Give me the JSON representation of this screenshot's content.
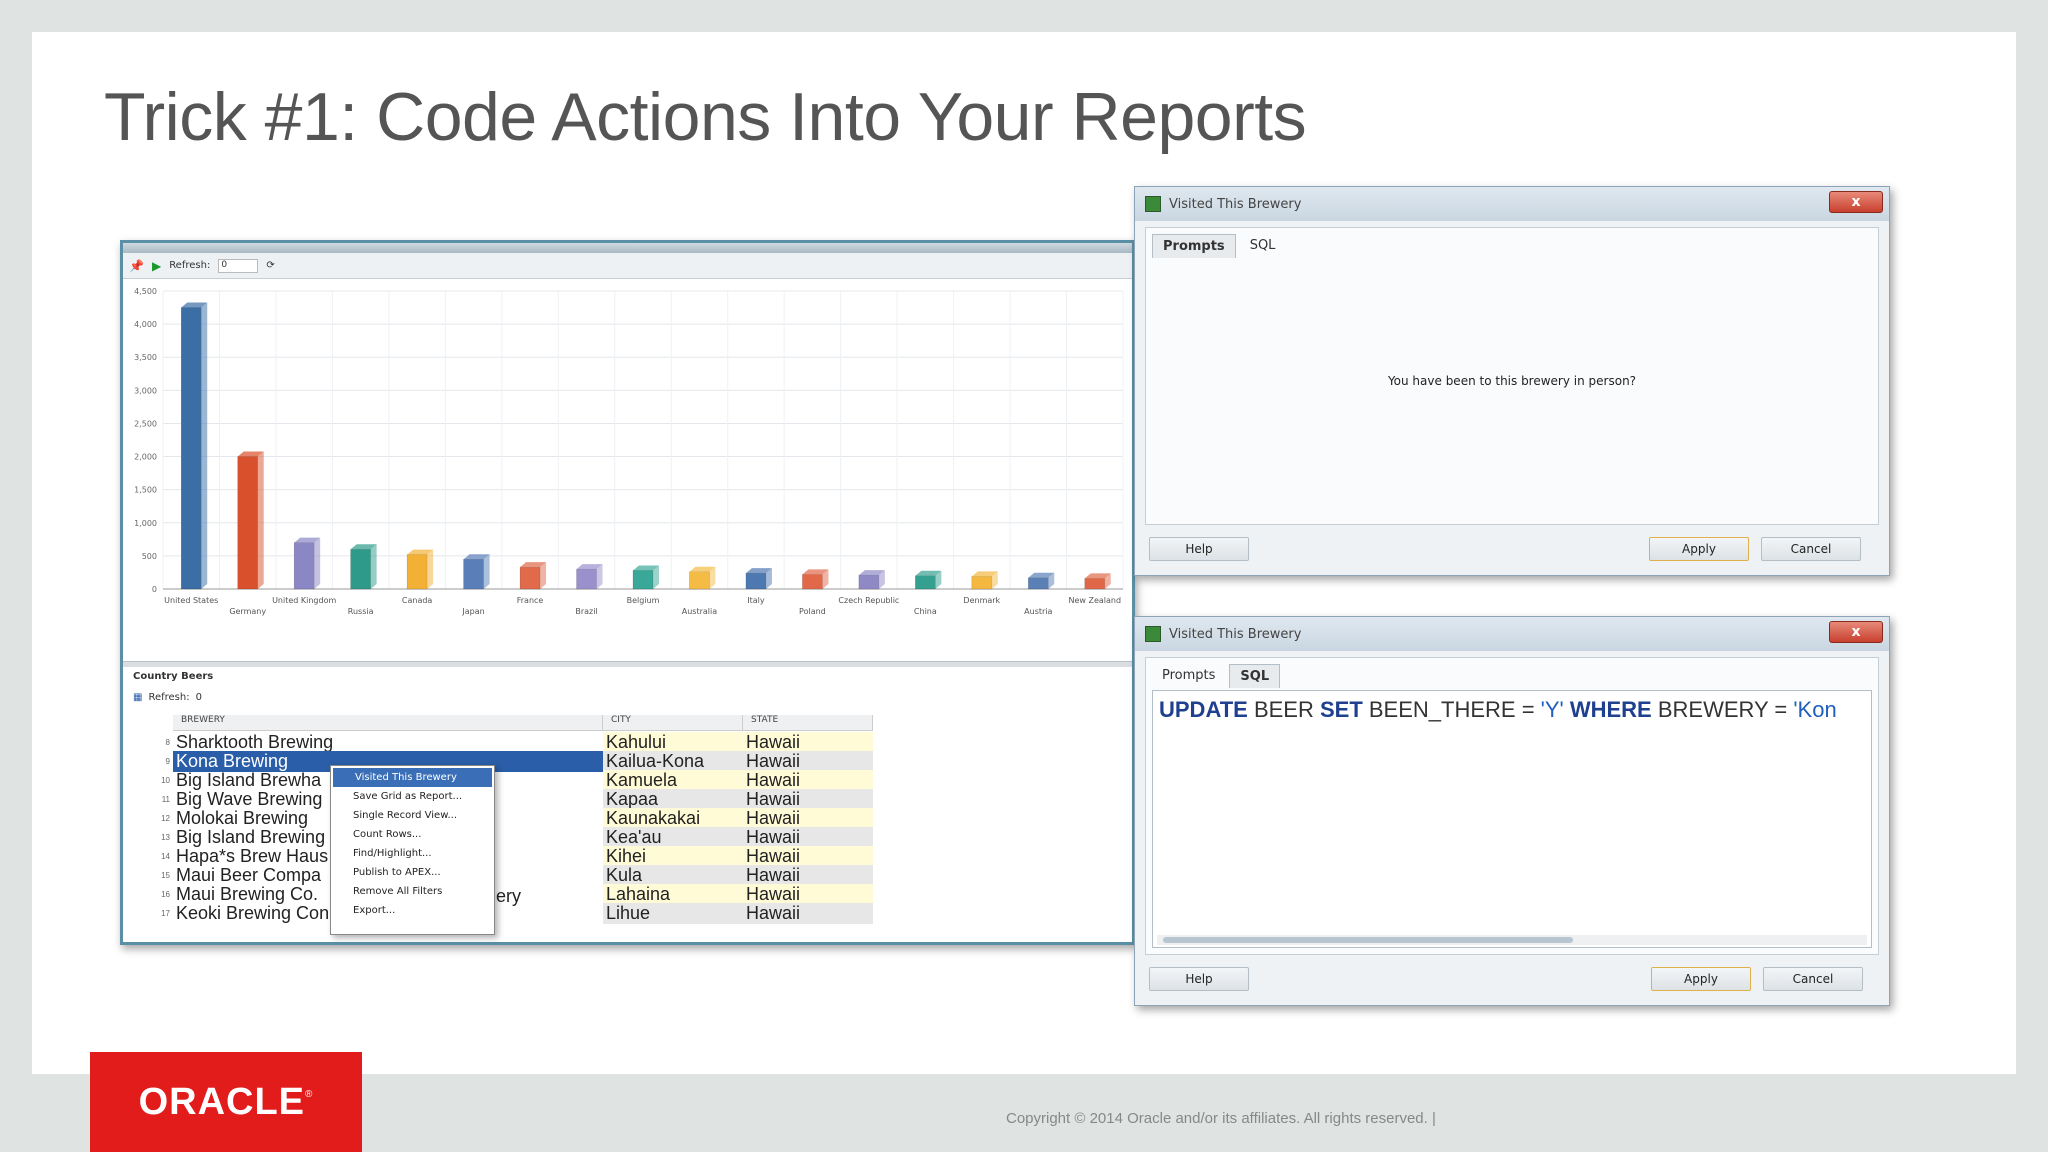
{
  "slide": {
    "title": "Trick #1: Code Actions Into Your Reports",
    "copyright": "Copyright © 2014 Oracle and/or its affiliates. All rights reserved.  |",
    "logo_text": "ORACLE"
  },
  "report": {
    "toolbar_refresh_label": "Refresh:",
    "toolbar_refresh_value": "0",
    "grid_title": "Country Beers",
    "grid_refresh_label": "Refresh:",
    "grid_refresh_value": "0",
    "columns": [
      "BREWERY",
      "CITY",
      "STATE"
    ],
    "rows": [
      {
        "n": "8",
        "brewery": "Sharktooth Brewing",
        "city": "Kahului",
        "state": "Hawaii"
      },
      {
        "n": "9",
        "brewery": "Kona Brewing",
        "city": "Kailua-Kona",
        "state": "Hawaii"
      },
      {
        "n": "10",
        "brewery": "Big Island Brewha",
        "city": "Kamuela",
        "state": "Hawaii"
      },
      {
        "n": "11",
        "brewery": "Big Wave Brewing",
        "city": "Kapaa",
        "state": "Hawaii"
      },
      {
        "n": "12",
        "brewery": "Molokai Brewing",
        "city": "Kaunakakai",
        "state": "Hawaii"
      },
      {
        "n": "13",
        "brewery": "Big Island Brewing",
        "city": "Kea'au",
        "state": "Hawaii"
      },
      {
        "n": "14",
        "brewery": "Hapa*s Brew Haus",
        "city": "Kihei",
        "state": "Hawaii"
      },
      {
        "n": "15",
        "brewery": "Maui Beer Compa",
        "city": "Kula",
        "state": "Hawaii"
      },
      {
        "n": "16",
        "brewery": "Maui Brewing Co.",
        "city": "Lahaina",
        "state": "Hawaii"
      },
      {
        "n": "17",
        "brewery": "Keoki Brewing Con",
        "city": "Lihue",
        "state": "Hawaii"
      }
    ],
    "partial_text": "ery",
    "context_menu": [
      "Visited This Brewery",
      "Save Grid as Report...",
      "Single Record View...",
      "Count Rows...",
      "Find/Highlight...",
      "Publish to APEX...",
      "Remove All Filters",
      "Export..."
    ]
  },
  "chart_data": {
    "type": "bar",
    "categories": [
      "United States",
      "Germany",
      "United Kingdom",
      "Russia",
      "Canada",
      "Japan",
      "France",
      "Brazil",
      "Belgium",
      "Australia",
      "Italy",
      "Poland",
      "Czech Republic",
      "China",
      "Denmark",
      "Austria",
      "New Zealand"
    ],
    "values": [
      4250,
      2000,
      700,
      600,
      520,
      450,
      330,
      300,
      280,
      260,
      240,
      220,
      210,
      200,
      190,
      170,
      160
    ],
    "ylim": [
      0,
      4500
    ],
    "yticks": [
      "4,500",
      "4,000",
      "3,500",
      "3,000",
      "2,500",
      "2,000",
      "1,500",
      "1,000",
      "500",
      "0"
    ],
    "colors": [
      "#3a6ea5",
      "#d9512c",
      "#8b86c4",
      "#2e9a8a",
      "#f2b035",
      "#5a7fb8",
      "#e06a4a",
      "#9a90cc",
      "#3aa898",
      "#f5bc45",
      "#4e78b0",
      "#e2684a",
      "#8f8ac6",
      "#36a090",
      "#f4b840",
      "#5a80b6",
      "#e06848"
    ],
    "grid": true
  },
  "dialog1": {
    "title": "Visited This Brewery",
    "close_label": "x",
    "tabs": [
      "Prompts",
      "SQL"
    ],
    "prompt": "You have been to this brewery in person?",
    "help_label": "Help",
    "apply_label": "Apply",
    "cancel_label": "Cancel"
  },
  "dialog2": {
    "title": "Visited This Brewery",
    "close_label": "x",
    "tabs": [
      "Prompts",
      "SQL"
    ],
    "sql": {
      "kw1": "UPDATE",
      "t1": " BEER ",
      "kw2": "SET",
      "t2": " BEEN_THERE = ",
      "s1": "'Y'",
      "kw3": " WHERE",
      "t3": " BREWERY = ",
      "s2": "'Kon"
    },
    "help_label": "Help",
    "apply_label": "Apply",
    "cancel_label": "Cancel"
  }
}
